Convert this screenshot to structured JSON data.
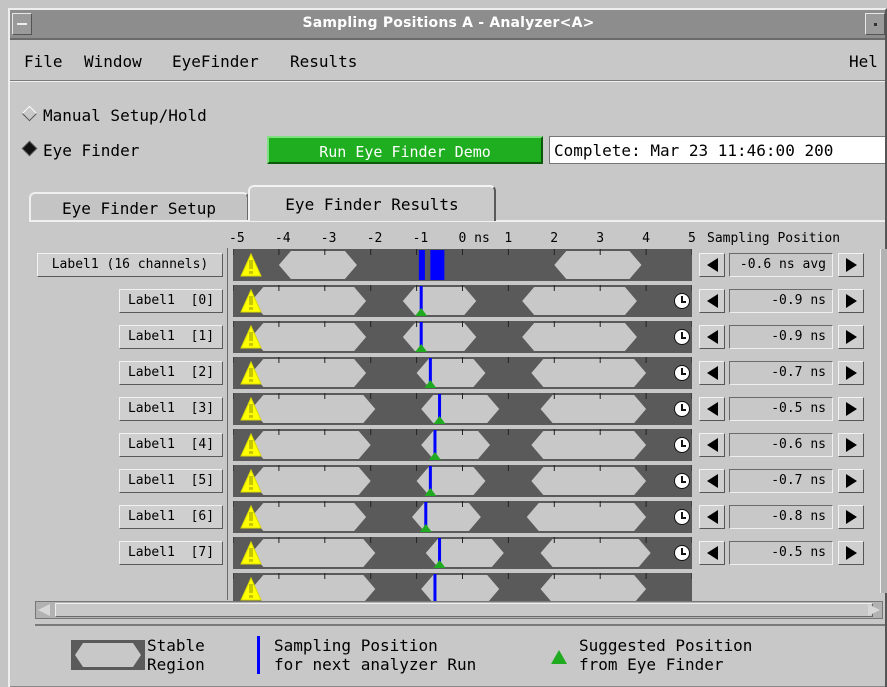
{
  "window": {
    "title": "Sampling Positions A - Analyzer<A>"
  },
  "menu": {
    "file": "File",
    "window": "Window",
    "eyefinder": "EyeFinder",
    "results": "Results",
    "help": "Hel"
  },
  "mode": {
    "manual": "Manual Setup/Hold",
    "eyefinder": "Eye Finder",
    "selected": "Eye Finder"
  },
  "run_button": "Run Eye Finder Demo",
  "status": "Complete: Mar 23 11:46:00 200",
  "tabs": {
    "setup": "Eye Finder Setup",
    "results": "Eye Finder Results",
    "active": "Eye Finder Results"
  },
  "header": {
    "ticks": [
      "-5",
      "-4",
      "-3",
      "-2",
      "-1",
      "0 ns",
      "1",
      "2",
      "3",
      "4",
      "5"
    ],
    "sampling_position": "Sampling Position"
  },
  "rows": [
    {
      "label": "Label1 (16 channels)",
      "value": "-0.6 ns avg",
      "sample_ns": -0.6
    },
    {
      "label": "Label1  [0]",
      "value": "-0.9 ns",
      "sample_ns": -0.9
    },
    {
      "label": "Label1  [1]",
      "value": "-0.9 ns",
      "sample_ns": -0.9
    },
    {
      "label": "Label1  [2]",
      "value": "-0.7 ns",
      "sample_ns": -0.7
    },
    {
      "label": "Label1  [3]",
      "value": "-0.5 ns",
      "sample_ns": -0.5
    },
    {
      "label": "Label1  [4]",
      "value": "-0.6 ns",
      "sample_ns": -0.6
    },
    {
      "label": "Label1  [5]",
      "value": "-0.7 ns",
      "sample_ns": -0.7
    },
    {
      "label": "Label1  [6]",
      "value": "-0.8 ns",
      "sample_ns": -0.8
    },
    {
      "label": "Label1  [7]",
      "value": "-0.5 ns",
      "sample_ns": -0.5
    }
  ],
  "legend": {
    "stable": "Stable\nRegion",
    "sampling": "Sampling Position\nfor next analyzer Run",
    "suggested": "Suggested Position\nfrom Eye Finder"
  },
  "colors": {
    "stable": "#c8c8c8",
    "unstable": "#5a5a5a",
    "sampling_line": "#0000ff",
    "suggested": "#1faa1f",
    "warning": "#ffff00"
  }
}
